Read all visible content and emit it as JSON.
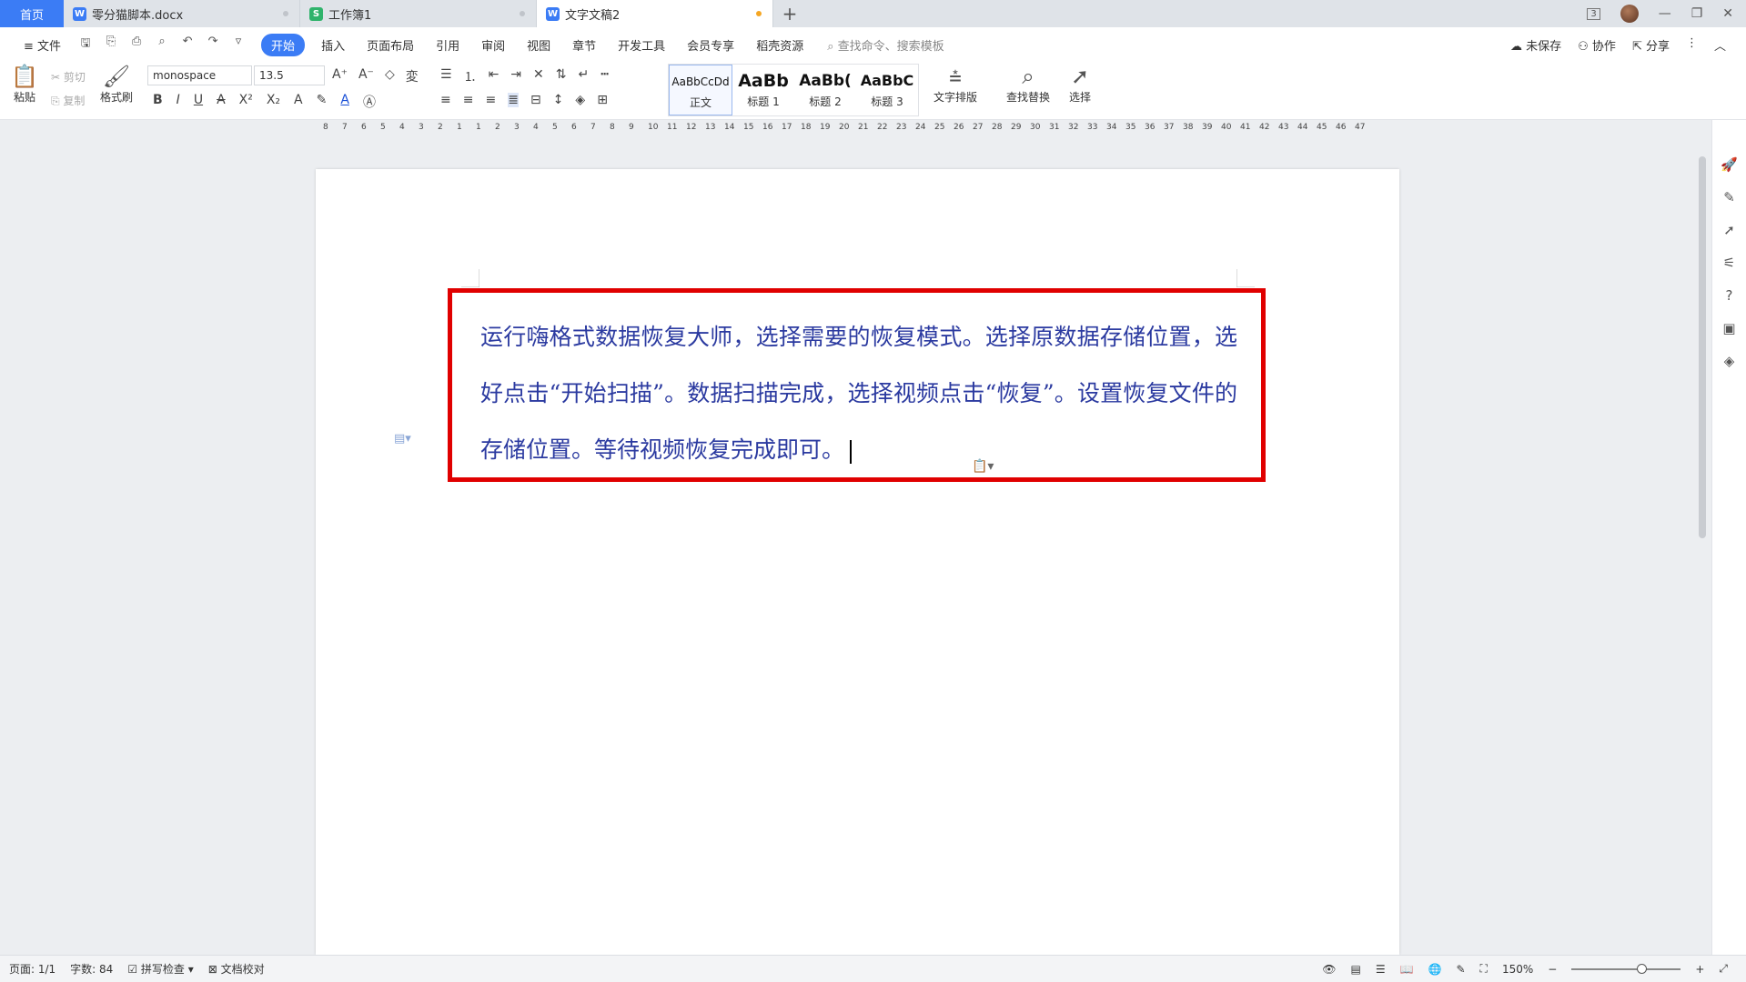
{
  "tabs": {
    "home": "首页",
    "items": [
      {
        "label": "零分猫脚本.docx",
        "badge": "W",
        "badge_color": "#3b7cf5"
      },
      {
        "label": "工作簿1",
        "badge": "S",
        "badge_color": "#2fb36b"
      },
      {
        "label": "文字文稿2",
        "badge": "W",
        "badge_color": "#3b7cf5"
      }
    ],
    "add": "+",
    "window_count": "3"
  },
  "menu": {
    "file": "文件",
    "items": [
      "开始",
      "插入",
      "页面布局",
      "引用",
      "审阅",
      "视图",
      "章节",
      "开发工具",
      "会员专享",
      "稻壳资源"
    ],
    "search_placeholder": "查找命令、搜索模板",
    "unsaved": "未保存",
    "collab": "协作",
    "share": "分享"
  },
  "ribbon": {
    "paste": "粘贴",
    "cut": "剪切",
    "copy": "复制",
    "format_painter": "格式刷",
    "font_name": "monospace",
    "font_size": "13.5",
    "styles": [
      {
        "sample": "AaBbCcDd",
        "label": "正文"
      },
      {
        "sample": "AaBb",
        "label": "标题 1"
      },
      {
        "sample": "AaBb(",
        "label": "标题 2"
      },
      {
        "sample": "AaBbC",
        "label": "标题 3"
      }
    ],
    "text_layout": "文字排版",
    "find_replace": "查找替换",
    "select": "选择"
  },
  "document": {
    "text": "运行嗨格式数据恢复大师，选择需要的恢复模式。选择原数据存储位置，选好点击“开始扫描”。数据扫描完成，选择视频点击“恢复”。设置恢复文件的存储位置。等待视频恢复完成即可。"
  },
  "status": {
    "page": "页面: 1/1",
    "words": "字数: 84",
    "spell_check": "拼写检查",
    "doc_check": "文档校对",
    "zoom": "150%"
  },
  "ruler": {
    "h_ticks": [
      "8",
      "7",
      "6",
      "5",
      "4",
      "3",
      "2",
      "1",
      "1",
      "2",
      "3",
      "4",
      "5",
      "6",
      "7",
      "8",
      "9",
      "10",
      "11",
      "12",
      "13",
      "14",
      "15",
      "16",
      "17",
      "18",
      "19",
      "20",
      "21",
      "22",
      "23",
      "24",
      "25",
      "26",
      "27",
      "28",
      "29",
      "30",
      "31",
      "32",
      "33",
      "34",
      "35",
      "36",
      "37",
      "38",
      "39",
      "40",
      "41",
      "42",
      "43",
      "44",
      "45",
      "46",
      "47"
    ]
  }
}
